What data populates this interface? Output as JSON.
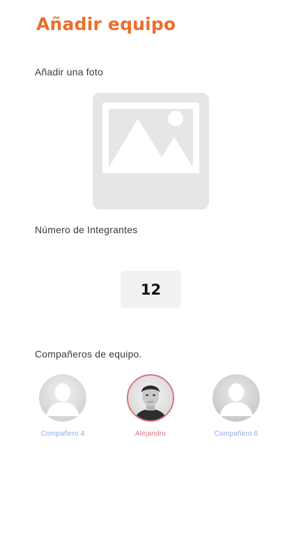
{
  "header": {
    "title": "Añadir equipo"
  },
  "photo": {
    "label": "Añadir una foto",
    "icon": "image-placeholder-icon"
  },
  "members_count": {
    "label": "Número de Integrantes",
    "value": "12"
  },
  "team": {
    "label": "Compañeros de equipo.",
    "members": [
      {
        "name": "Compañero 4",
        "avatar": "default-user-icon",
        "selected": false,
        "color": "#8fa7e6"
      },
      {
        "name": "Alejandro",
        "avatar": "photo",
        "selected": true,
        "color": "#d9707a"
      },
      {
        "name": "Compañero 6",
        "avatar": "default-user-icon",
        "selected": false,
        "color": "#8fa7e6"
      }
    ]
  },
  "colors": {
    "accent": "#ec6e2a",
    "selected_ring": "#d9707a",
    "member_link": "#8fa7e6"
  }
}
